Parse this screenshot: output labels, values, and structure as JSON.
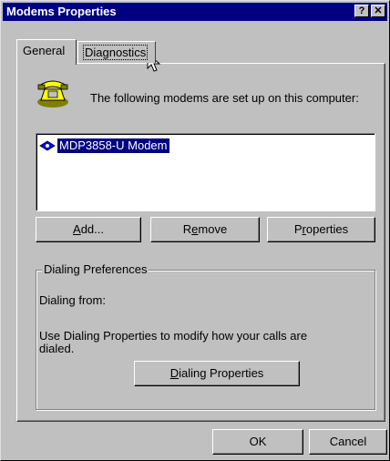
{
  "window": {
    "title": "Modems Properties"
  },
  "titlebar": {
    "help_label": "?",
    "close_label": "✕"
  },
  "tabs": [
    {
      "label": "General"
    },
    {
      "label": "Diagnostics"
    }
  ],
  "general": {
    "intro_text": "The following modems are set up on this computer:",
    "modems": [
      {
        "label": "MDP3858-U Modem"
      }
    ],
    "buttons": {
      "add": {
        "pre": "",
        "ul": "A",
        "post": "dd..."
      },
      "remove": {
        "pre": "R",
        "ul": "e",
        "post": "move"
      },
      "properties": {
        "pre": "P",
        "ul": "r",
        "post": "operties"
      }
    },
    "dialing": {
      "title": "Dialing Preferences",
      "from_label": "Dialing from:",
      "note": "Use Dialing Properties to modify how your calls are dialed.",
      "button": {
        "pre": "",
        "ul": "D",
        "post": "ialing Properties"
      }
    }
  },
  "footer": {
    "ok_label": "OK",
    "cancel_label": "Cancel"
  }
}
